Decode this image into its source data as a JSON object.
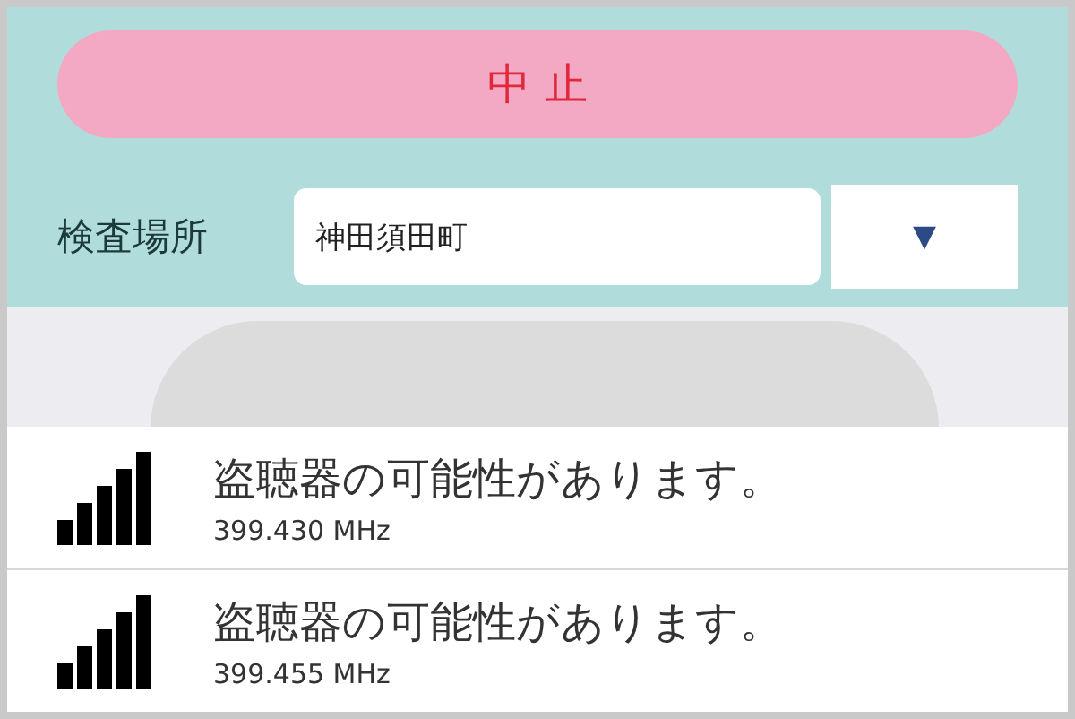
{
  "stop_button": {
    "label": "中 止"
  },
  "location": {
    "label": "検査場所",
    "value": "神田須田町",
    "dropdown_glyph": "▼"
  },
  "detections": [
    {
      "message": "盗聴器の可能性があります。",
      "frequency": "399.430 MHz"
    },
    {
      "message": "盗聴器の可能性があります。",
      "frequency": "399.455 MHz"
    }
  ]
}
